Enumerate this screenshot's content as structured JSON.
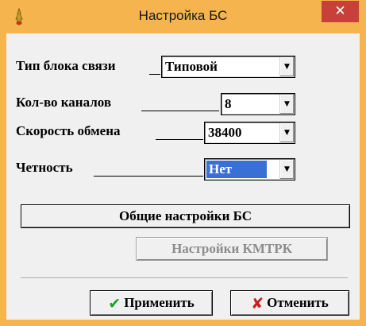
{
  "window": {
    "title": "Настройка БС",
    "close_glyph": "✕"
  },
  "fields": {
    "link_type": {
      "label": "Тип блока связи",
      "value": "Типовой"
    },
    "channels": {
      "label": "Кол-во каналов",
      "value": "8"
    },
    "baud": {
      "label": "Скорость обмена",
      "value": "38400"
    },
    "parity": {
      "label": "Четность",
      "value": "Нет"
    }
  },
  "buttons": {
    "general": "Общие настройки БС",
    "kmtrk": "Настройки КМТРК",
    "apply": "Применить",
    "cancel": "Отменить"
  },
  "icons": {
    "apply": "checkmark-icon",
    "cancel": "x-mark-icon",
    "title": "app-icon"
  },
  "colors": {
    "titlebar": "#f5b44e",
    "close": "#c7413a",
    "selection": "#3a70d6",
    "apply_icon": "#1aa32a",
    "cancel_icon": "#c81e1e"
  }
}
